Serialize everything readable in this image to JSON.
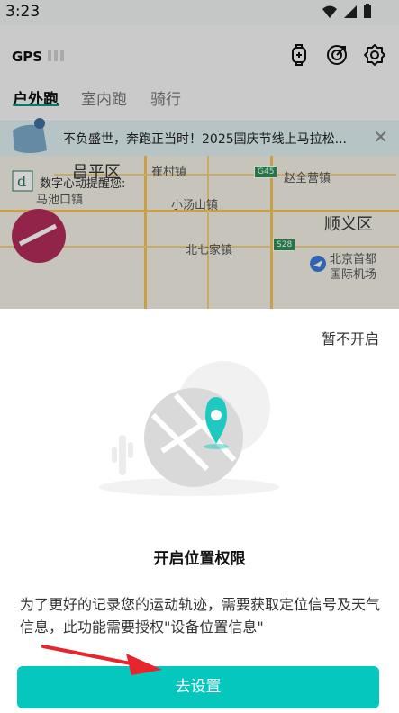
{
  "status_bar": {
    "time": "3:23"
  },
  "header": {
    "gps_label": "GPS"
  },
  "tabs": [
    {
      "label": "户外跑",
      "active": true
    },
    {
      "label": "室内跑",
      "active": false
    },
    {
      "label": "骑行",
      "active": false
    }
  ],
  "banner": {
    "text": "不负盛世，奔跑正当时！2025国庆节线上马拉松...",
    "close": "✕"
  },
  "map": {
    "labels": [
      "昌平区",
      "崔村镇",
      "赵全营镇",
      "数字心动提醒您:",
      "马池口镇",
      "小汤山镇",
      "顺义区",
      "北七家镇",
      "北京首都",
      "国际机场"
    ],
    "shields": [
      "G45",
      "S28"
    ]
  },
  "sheet": {
    "dismiss": "暂不开启",
    "title": "开启位置权限",
    "description": "为了更好的记录您的运动轨迹，需要获取定位信号及天气信息，此功能需要授权\"设备位置信息\"",
    "button": "去设置"
  },
  "colors": {
    "accent": "#06c7bd",
    "tab_underline": "#1e8b7c"
  }
}
